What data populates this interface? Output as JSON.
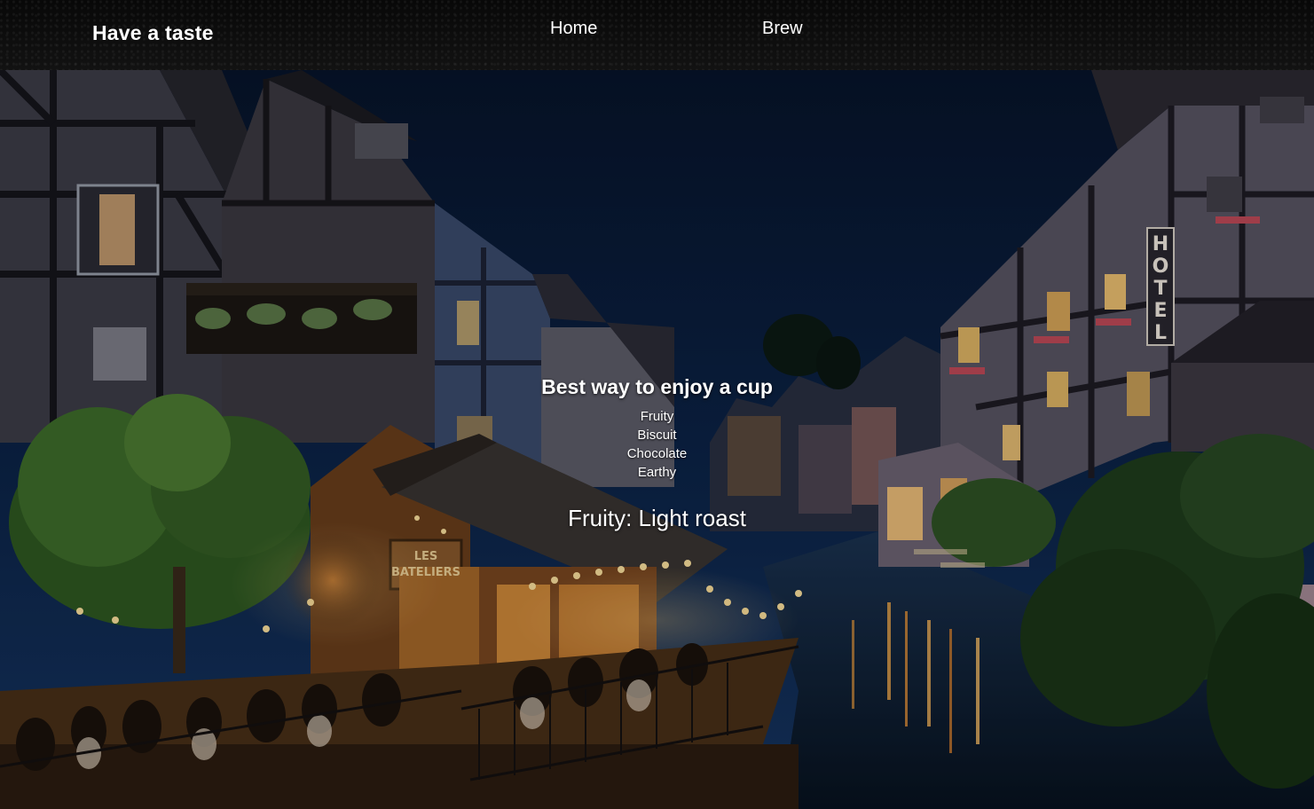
{
  "header": {
    "brand": "Have a taste",
    "nav": [
      {
        "label": "Home"
      },
      {
        "label": "Brew"
      }
    ]
  },
  "hero": {
    "background_image": "night-canal-village-scene",
    "headline": "Best way to enjoy a cup",
    "flavors": [
      "Fruity",
      "Biscuit",
      "Chocolate",
      "Earthy"
    ],
    "result": "Fruity: Light roast",
    "hotel_sign": "HOTEL",
    "restaurant_sign": [
      "LES",
      "BATELIERS"
    ]
  },
  "colors": {
    "navbar": "#0a0a0a",
    "text": "#ffffff",
    "sky": "#0b1f3f",
    "warm_light": "#f2b35a",
    "canal": "#0e2038"
  }
}
